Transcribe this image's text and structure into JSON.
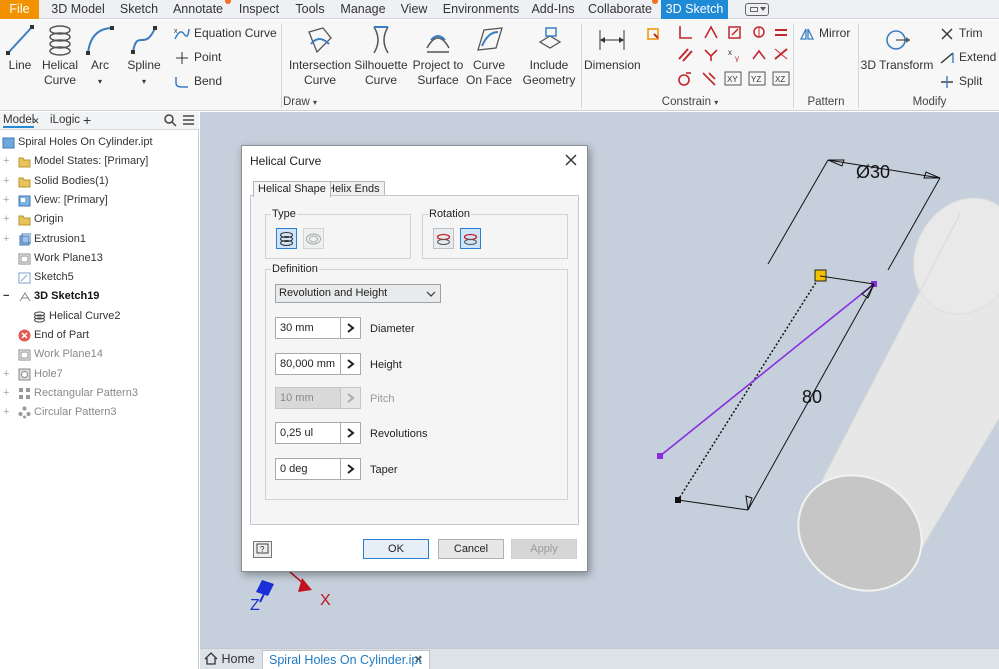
{
  "menubar": {
    "tabs": [
      "File",
      "3D Model",
      "Sketch",
      "Annotate",
      "Inspect",
      "Tools",
      "Manage",
      "View",
      "Environments",
      "Add-Ins",
      "Collaborate",
      "3D Sketch"
    ],
    "active_tab": "3D Sketch"
  },
  "ribbon": {
    "draw": {
      "line": "Line",
      "helical_1": "Helical",
      "helical_2": "Curve",
      "arc": "Arc",
      "spline": "Spline",
      "equation_curve": "Equation Curve",
      "point": "Point",
      "bend": "Bend",
      "intersection_1": "Intersection",
      "intersection_2": "Curve",
      "silhouette_1": "Silhouette",
      "silhouette_2": "Curve",
      "project_1": "Project to",
      "project_2": "Surface",
      "curve_on_face_1": "Curve",
      "curve_on_face_2": "On Face",
      "include_1": "Include",
      "include_2": "Geometry",
      "group_label": "Draw"
    },
    "constrain": {
      "dimension": "Dimension",
      "group_label": "Constrain"
    },
    "pattern": {
      "mirror": "Mirror",
      "group_label": "Pattern"
    },
    "modify": {
      "transform": "3D Transform",
      "trim": "Trim",
      "extend": "Extend",
      "split": "Split",
      "group_label": "Modify"
    }
  },
  "browser": {
    "tabs": {
      "model": "Model",
      "ilogic": "iLogic"
    },
    "items": [
      {
        "label": "Spiral Holes On Cylinder.ipt"
      },
      {
        "label": "Model States: [Primary]"
      },
      {
        "label": "Solid Bodies(1)"
      },
      {
        "label": "View: [Primary]"
      },
      {
        "label": "Origin"
      },
      {
        "label": "Extrusion1"
      },
      {
        "label": "Work Plane13"
      },
      {
        "label": "Sketch5"
      },
      {
        "label": "3D Sketch19"
      },
      {
        "label": "Helical Curve2"
      },
      {
        "label": "End of Part"
      },
      {
        "label": "Work Plane14"
      },
      {
        "label": "Hole7"
      },
      {
        "label": "Rectangular Pattern3"
      },
      {
        "label": "Circular Pattern3"
      }
    ]
  },
  "dialog": {
    "title": "Helical Curve",
    "tabs": {
      "shape": "Helical Shape",
      "ends": "Helix Ends"
    },
    "type_label": "Type",
    "rotation_label": "Rotation",
    "definition_label": "Definition",
    "definition_value": "Revolution and Height",
    "fields": {
      "diameter": {
        "value": "30 mm",
        "label": "Diameter"
      },
      "height": {
        "value": "80,000 mm",
        "label": "Height"
      },
      "pitch": {
        "value": "10 mm",
        "label": "Pitch"
      },
      "revolutions": {
        "value": "0,25 ul",
        "label": "Revolutions"
      },
      "taper": {
        "value": "0 deg",
        "label": "Taper"
      }
    },
    "buttons": {
      "ok": "OK",
      "cancel": "Cancel",
      "apply": "Apply"
    }
  },
  "viewport": {
    "dim_diameter": "Ø30",
    "dim_height": "80",
    "triad": {
      "x": "X",
      "z": "Z"
    }
  },
  "doc_tabs": {
    "home": "Home",
    "doc": "Spiral Holes On Cylinder.ipt"
  },
  "colors": {
    "accent": "#1f8ad6",
    "file": "#f39200",
    "curve": "#8a2be2",
    "viewport": "#c6d0dc"
  }
}
